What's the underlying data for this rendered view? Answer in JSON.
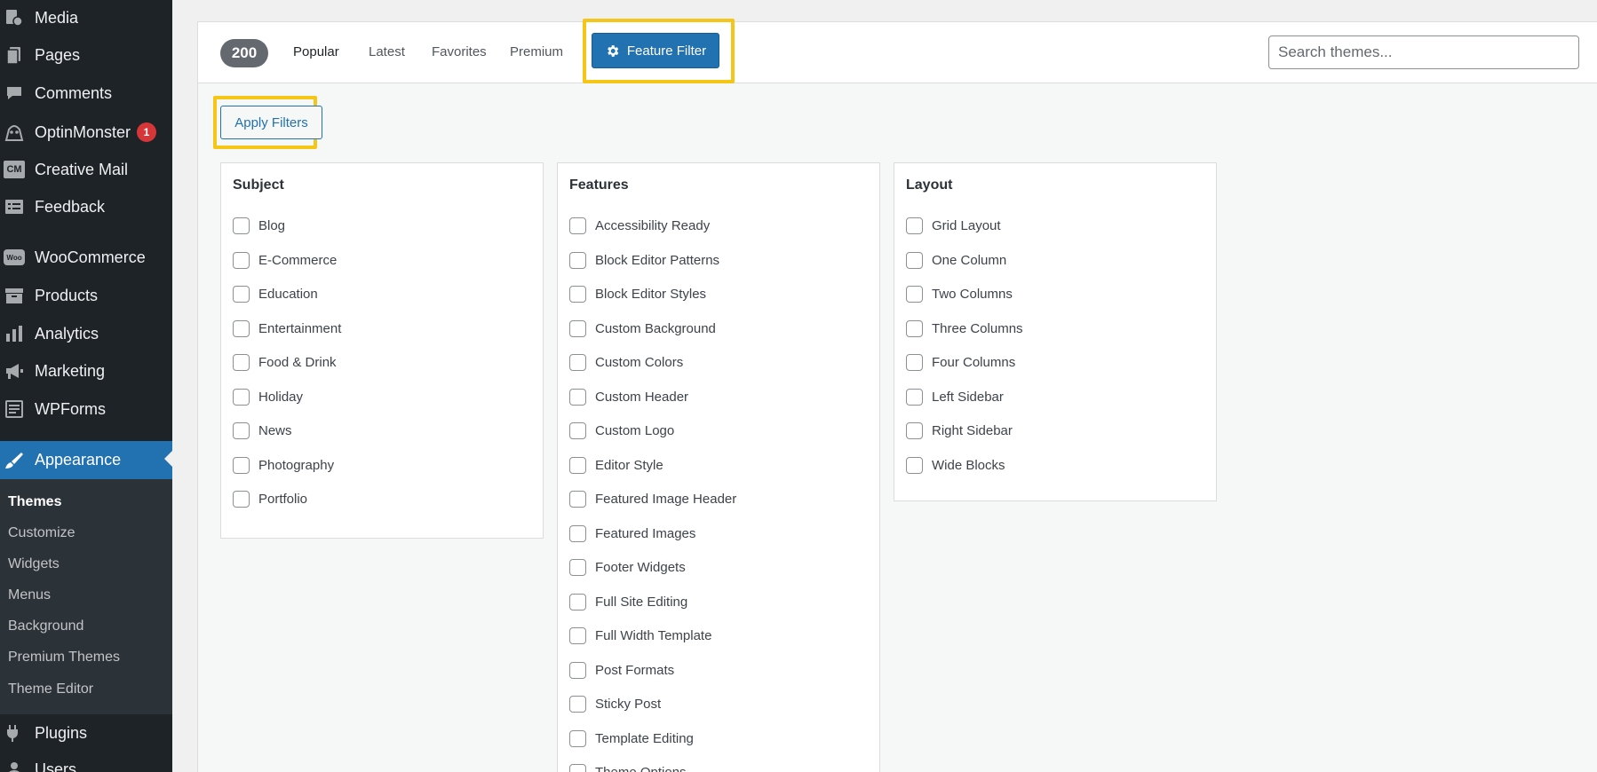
{
  "sidebar": {
    "items": [
      {
        "label": "Media",
        "icon": "media-icon"
      },
      {
        "label": "Pages",
        "icon": "pages-icon"
      },
      {
        "label": "Comments",
        "icon": "comments-icon"
      },
      {
        "label": "OptinMonster",
        "icon": "optinmonster-icon",
        "badge": "1"
      },
      {
        "label": "Creative Mail",
        "icon": "creative-mail-icon",
        "icon_text": "CM"
      },
      {
        "label": "Feedback",
        "icon": "feedback-icon"
      },
      {
        "label": "WooCommerce",
        "icon": "woocommerce-icon",
        "icon_text": "Woo"
      },
      {
        "label": "Products",
        "icon": "products-icon"
      },
      {
        "label": "Analytics",
        "icon": "analytics-icon"
      },
      {
        "label": "Marketing",
        "icon": "marketing-icon"
      },
      {
        "label": "WPForms",
        "icon": "wpforms-icon"
      },
      {
        "label": "Appearance",
        "icon": "appearance-icon"
      },
      {
        "label": "Plugins",
        "icon": "plugins-icon"
      },
      {
        "label": "Users",
        "icon": "users-icon"
      }
    ],
    "submenu": [
      "Themes",
      "Customize",
      "Widgets",
      "Menus",
      "Background",
      "Premium Themes",
      "Theme Editor"
    ]
  },
  "filter_bar": {
    "count": "200",
    "links": [
      "Popular",
      "Latest",
      "Favorites",
      "Premium"
    ],
    "feature_filter_label": "Feature Filter",
    "search_placeholder": "Search themes..."
  },
  "apply_label": "Apply Filters",
  "groups": [
    {
      "title": "Subject",
      "options": [
        "Blog",
        "E-Commerce",
        "Education",
        "Entertainment",
        "Food & Drink",
        "Holiday",
        "News",
        "Photography",
        "Portfolio"
      ]
    },
    {
      "title": "Features",
      "options": [
        "Accessibility Ready",
        "Block Editor Patterns",
        "Block Editor Styles",
        "Custom Background",
        "Custom Colors",
        "Custom Header",
        "Custom Logo",
        "Editor Style",
        "Featured Image Header",
        "Featured Images",
        "Footer Widgets",
        "Full Site Editing",
        "Full Width Template",
        "Post Formats",
        "Sticky Post",
        "Template Editing",
        "Theme Options"
      ]
    },
    {
      "title": "Layout",
      "options": [
        "Grid Layout",
        "One Column",
        "Two Columns",
        "Three Columns",
        "Four Columns",
        "Left Sidebar",
        "Right Sidebar",
        "Wide Blocks"
      ]
    }
  ],
  "colors": {
    "sidebar_bg": "#1d2327",
    "accent": "#2271b1",
    "highlight": "#f5c518",
    "badge": "#d63638"
  }
}
